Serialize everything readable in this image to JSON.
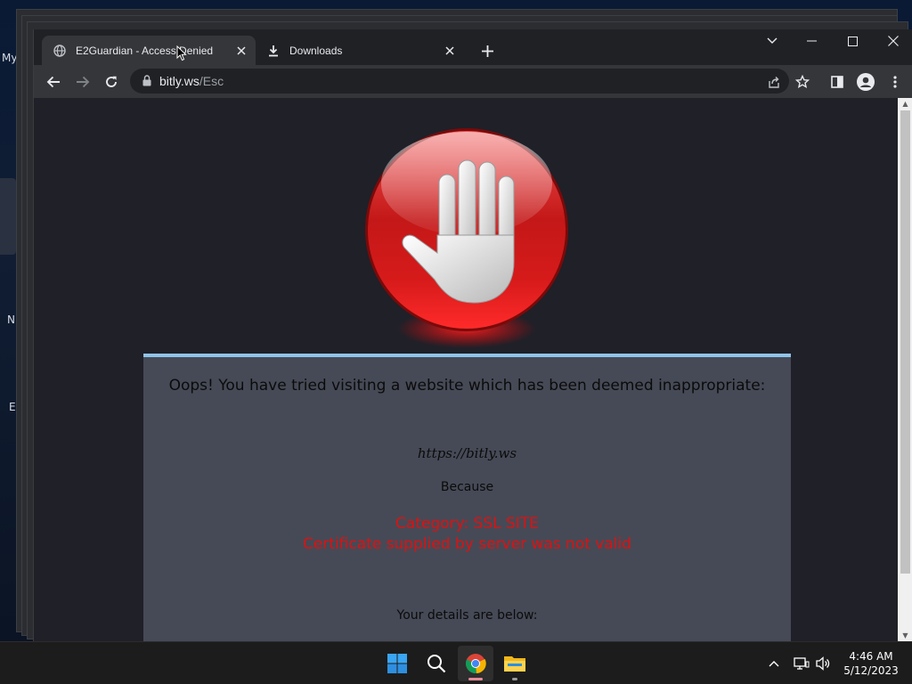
{
  "desktop": {
    "labels": [
      "My",
      "N",
      "E"
    ]
  },
  "browser": {
    "tabs": [
      {
        "label": "E2Guardian - Access Denied",
        "icon": "globe-icon"
      },
      {
        "label": "Downloads",
        "icon": "download-icon"
      }
    ],
    "omnibox": {
      "host": "bitly.ws",
      "path": "/Esc"
    }
  },
  "page": {
    "title": "Oops! You have tried visiting a website which has been deemed inappropriate:",
    "url": "https://bitly.ws",
    "because": "Because",
    "category": "Category: SSL SITE",
    "reason": "Certificate supplied by server was not valid",
    "details": "Your details are below:"
  },
  "taskbar": {
    "apps": [
      "start-icon",
      "search-icon",
      "chrome-icon",
      "file-explorer-icon"
    ],
    "time": "4:46 AM",
    "date": "5/12/2023"
  },
  "colors": {
    "accent_red": "#e01010",
    "panel_border": "#8fc4ea",
    "panel_bg": "#464a56",
    "page_bg": "#1f2028"
  }
}
